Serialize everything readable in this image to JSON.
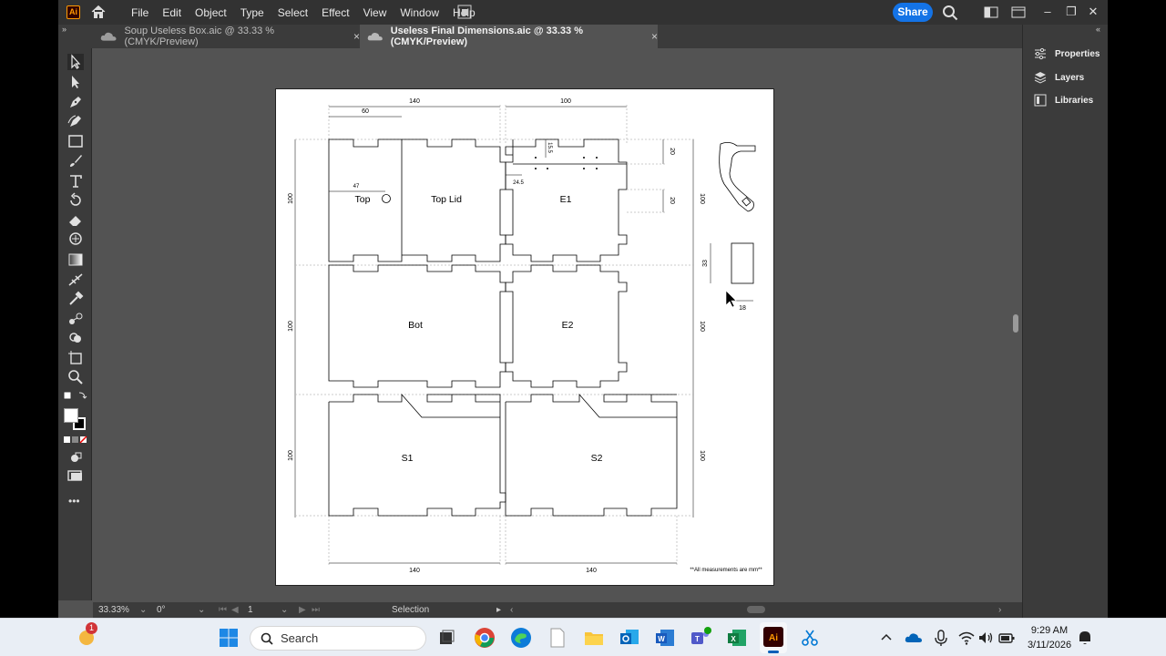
{
  "menubar": {
    "app_icon": "Ai",
    "items": [
      "File",
      "Edit",
      "Object",
      "Type",
      "Select",
      "Effect",
      "View",
      "Window",
      "Help"
    ],
    "share_label": "Share"
  },
  "tabs": [
    {
      "label": "Soup Useless Box.aic @ 33.33 % (CMYK/Preview)",
      "close": "×"
    },
    {
      "label": "Useless Final Dimensions.aic @ 33.33 % (CMYK/Preview)",
      "close": "×"
    }
  ],
  "right_panel": {
    "items": [
      {
        "label": "Properties",
        "icon": "properties-icon"
      },
      {
        "label": "Layers",
        "icon": "layers-icon"
      },
      {
        "label": "Libraries",
        "icon": "libraries-icon"
      }
    ]
  },
  "toolbar": {
    "tools": [
      "selection-tool",
      "direct-selection-tool",
      "pen-tool",
      "curvature-tool",
      "rectangle-tool",
      "paintbrush-tool",
      "type-tool",
      "rotate-tool",
      "eraser-tool",
      "warp-tool",
      "gradient-tool",
      "width-tool",
      "eyedropper-tool",
      "blend-tool",
      "shape-builder-tool",
      "artboard-tool",
      "zoom-tool"
    ],
    "more": "•••"
  },
  "artboard": {
    "top_dims": {
      "w1": "140",
      "w2": "100",
      "w3": "60"
    },
    "side_dims": {
      "left": [
        "100",
        "100",
        "100"
      ],
      "right": [
        "100",
        "100",
        "100"
      ],
      "tab_h1": "20",
      "tab_h2": "20",
      "small_15_5": "15.5",
      "small_24_5": "24.5",
      "small_47": "47"
    },
    "pieces": {
      "top": "Top",
      "top_lid": "Top Lid",
      "e1": "E1",
      "bot": "Bot",
      "e2": "E2",
      "s1": "S1",
      "s2": "S2"
    },
    "small_part": {
      "h": "33",
      "w": "18"
    },
    "bottom_dims": [
      "140",
      "140"
    ],
    "note": "**All measurements are mm**"
  },
  "status": {
    "zoom": "33.33%",
    "rotation": "0°",
    "artboard_number": "1",
    "tool_name": "Selection"
  },
  "taskbar": {
    "search_placeholder": "Search",
    "notification_badge": "1",
    "time": "9:29 AM",
    "date": "3/11/2026"
  }
}
